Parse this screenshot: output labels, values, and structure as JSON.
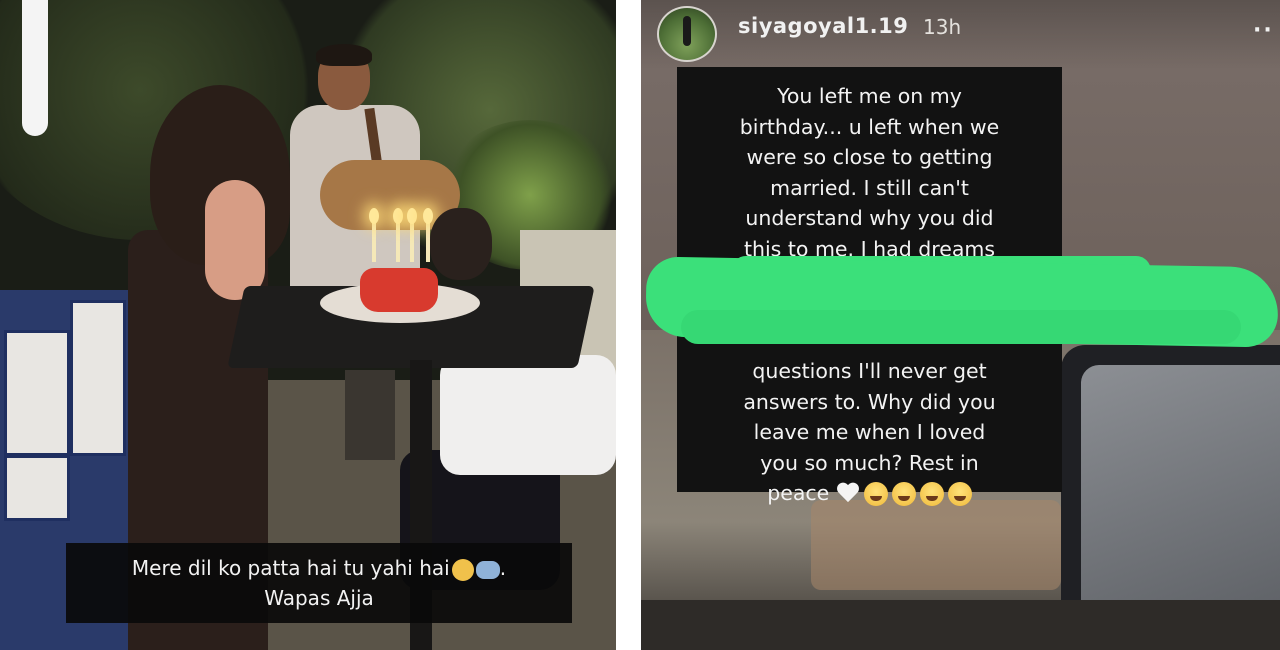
{
  "left_panel": {
    "caption_line1": "Mere dil ko patta hai tu yahi hai",
    "caption_line1_suffix": ".",
    "caption_line2": "Wapas Ajja",
    "caption_emojis": [
      "sad-face-emoji",
      "hugging-people-emoji"
    ]
  },
  "right_panel": {
    "username": "siyagoyal1.19",
    "time": "13h",
    "more_icon": "more-options-icon",
    "story_lines_top": [
      "You left me on my",
      "birthday... u left when we",
      "were so close to getting",
      "married. I still can't",
      "understand why you did",
      "this to me. I had dreams"
    ],
    "story_lines_bottom": [
      "questions I'll never get",
      "answers to. Why did you",
      "leave me when I loved",
      "you so much? Rest in",
      "peace"
    ],
    "end_emojis": [
      "white-heart-icon",
      "crying-face-icon",
      "crying-face-icon",
      "crying-face-icon",
      "crying-face-icon"
    ],
    "redaction_color": "#3be07a"
  }
}
